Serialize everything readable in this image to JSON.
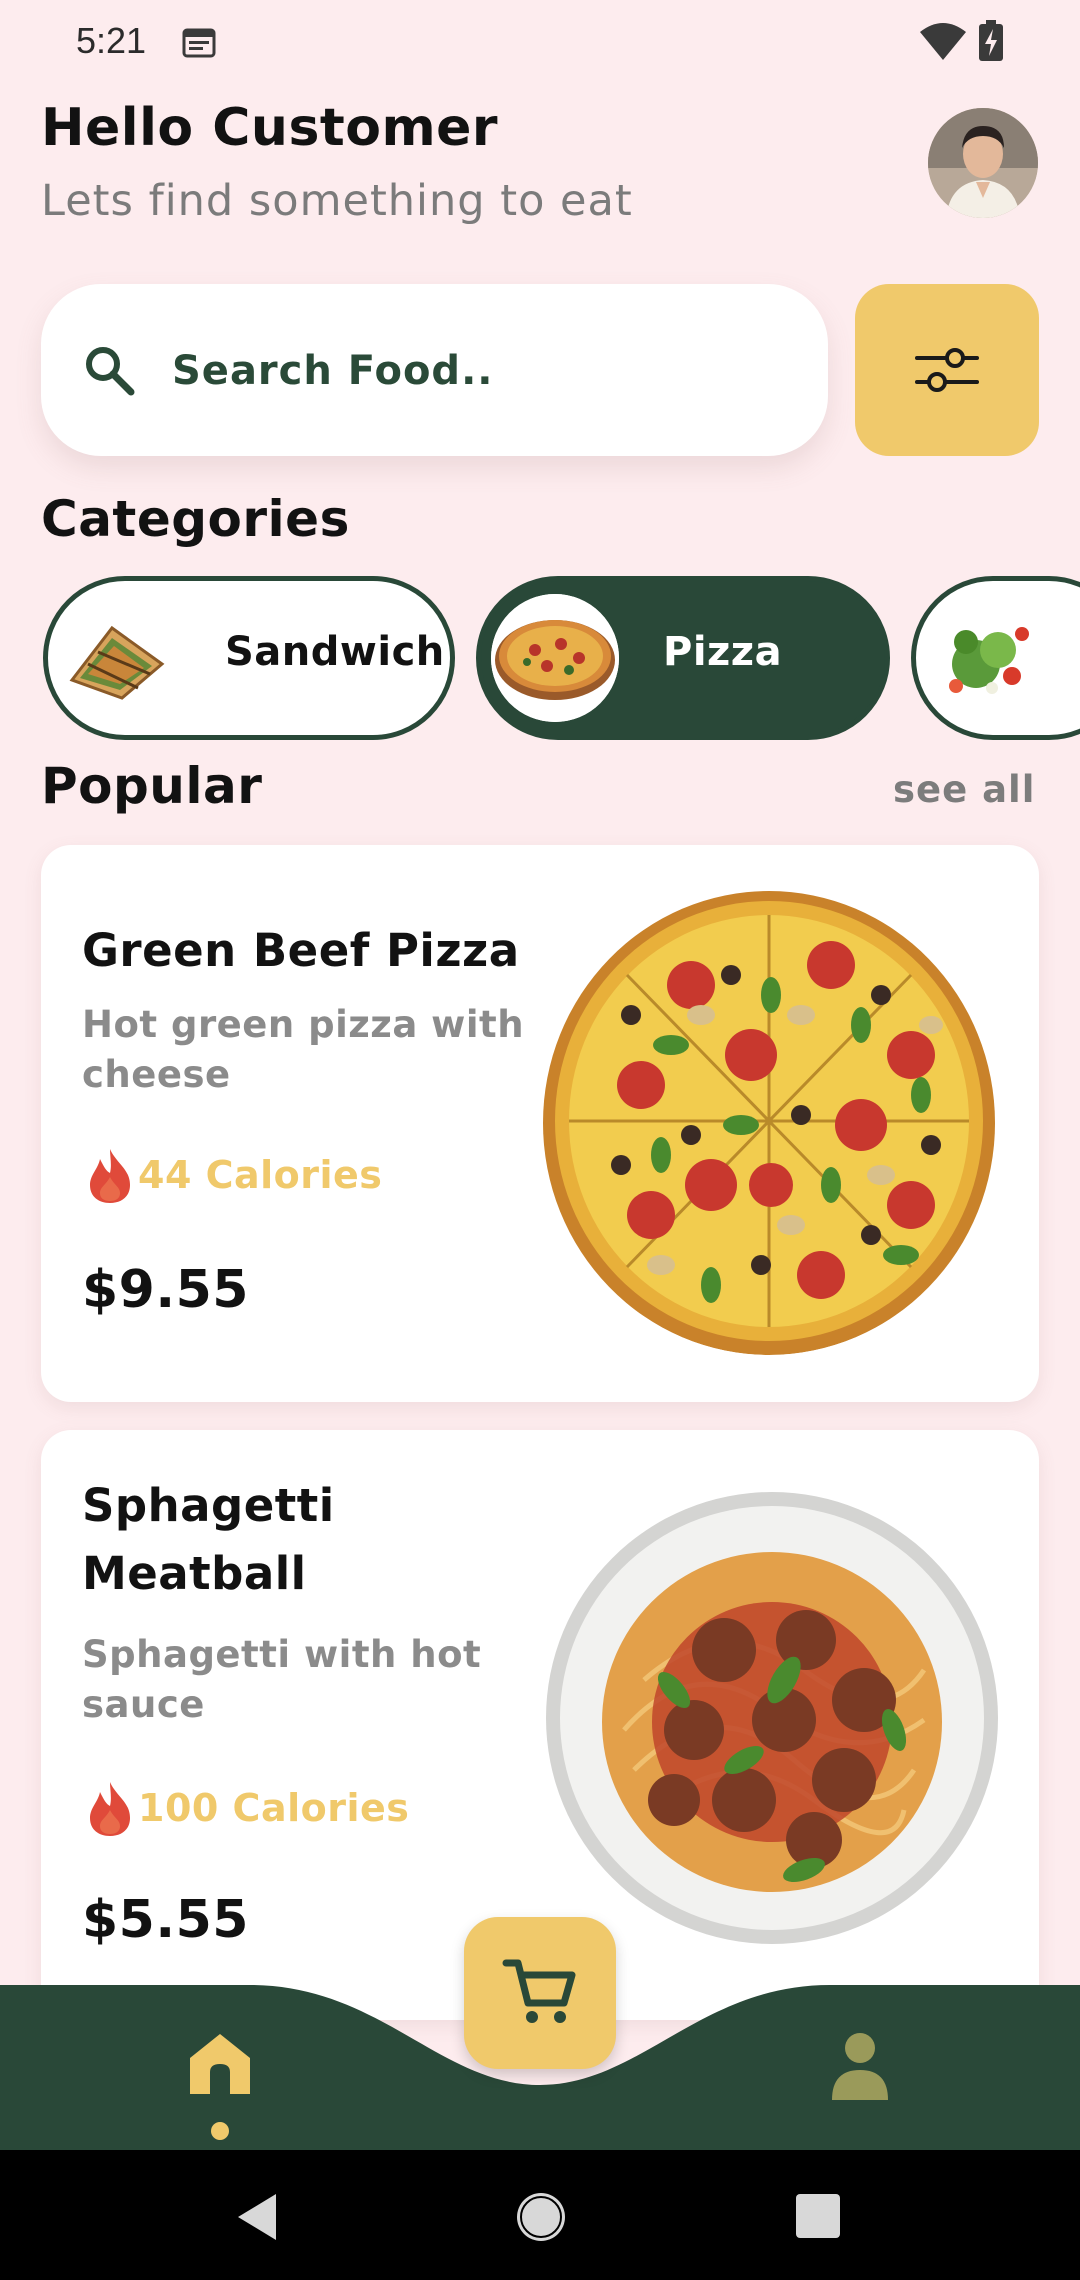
{
  "status_bar": {
    "time": "5:21"
  },
  "header": {
    "greeting": "Hello Customer",
    "subtitle": "Lets find something to eat"
  },
  "search": {
    "placeholder": "Search Food.."
  },
  "categories": {
    "title": "Categories",
    "items": [
      {
        "label": "Sandwich",
        "selected": false
      },
      {
        "label": "Pizza",
        "selected": true
      },
      {
        "label": "",
        "selected": false
      }
    ]
  },
  "popular": {
    "title": "Popular",
    "see_all": "see all",
    "items": [
      {
        "name": "Green Beef Pizza",
        "description": "Hot green pizza with cheese",
        "calories": "44 Calories",
        "price": "$9.55"
      },
      {
        "name": "Sphagetti Meatball",
        "description": "Sphagetti with hot sauce",
        "calories": "100 Calories",
        "price": "$5.55"
      }
    ]
  },
  "bottom_nav": {
    "items": [
      "home-icon",
      "cart-icon",
      "profile-icon"
    ],
    "active": "home"
  },
  "colors": {
    "background": "#fdecee",
    "primary_dark_green": "#294838",
    "accent_yellow": "#f0c96b",
    "text_dark": "#121212",
    "text_grey": "#8b8b8b"
  }
}
